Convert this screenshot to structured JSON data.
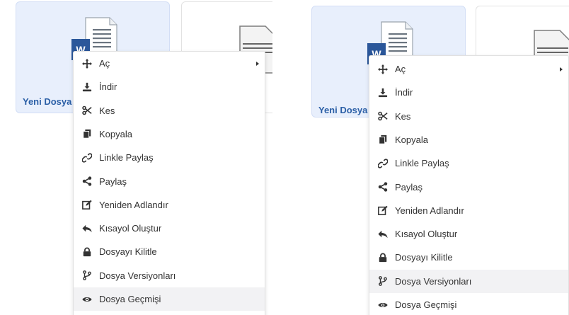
{
  "left": {
    "tile_name": "Yeni Dosya",
    "hover_item": "history"
  },
  "right": {
    "tile_name": "Yeni Dosya",
    "hover_item": "versions"
  },
  "menu": {
    "open": "Aç",
    "download": "İndir",
    "cut": "Kes",
    "copy": "Kopyala",
    "share_link": "Linkle Paylaş",
    "share": "Paylaş",
    "rename": "Yeniden Adlandır",
    "shortcut": "Kısayol Oluştur",
    "lock": "Dosyayı Kilitle",
    "versions": "Dosya Versiyonları",
    "history": "Dosya Geçmişi"
  },
  "icons": {
    "open": "move-icon",
    "download": "download-icon",
    "cut": "scissors-icon",
    "copy": "copy-icon",
    "share_link": "link-icon",
    "share": "share-icon",
    "rename": "edit-icon",
    "shortcut": "reply-arrow-icon",
    "lock": "lock-icon",
    "versions": "code-branch-icon",
    "history": "eye-icon"
  },
  "colors": {
    "selected_tile_bg": "#e8effc",
    "file_name": "#2b5fa6",
    "word_blue": "#2b579a",
    "menu_hover_bg": "#f2f2f4"
  }
}
